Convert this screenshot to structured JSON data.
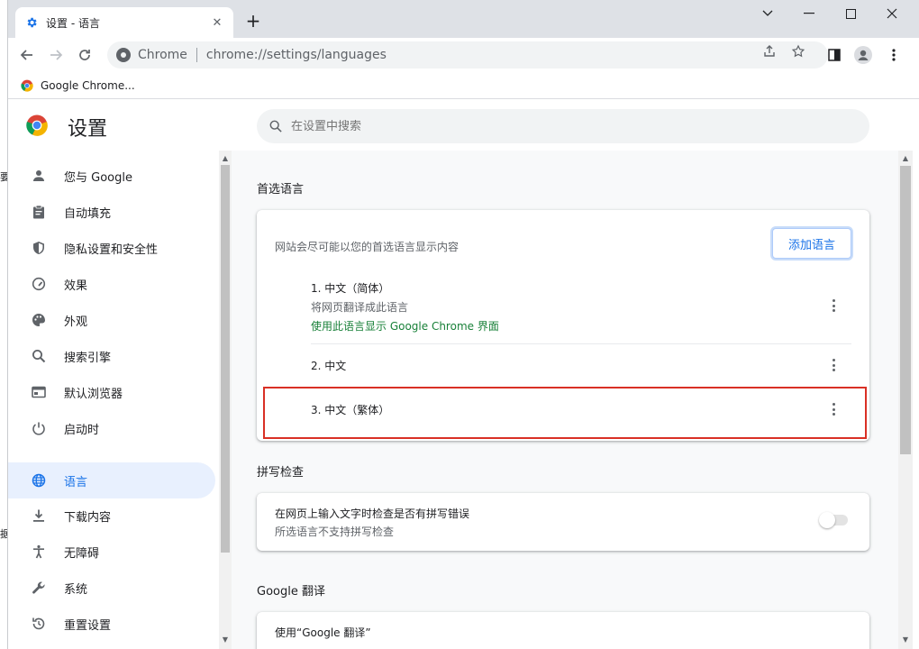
{
  "window": {
    "tab_title": "设置 - 语言",
    "tab_close": "✕",
    "new_tab": "+"
  },
  "toolbar": {
    "chip_label": "Chrome",
    "url": "chrome://settings/languages"
  },
  "bookmarks": [
    {
      "label": "Google Chrome..."
    }
  ],
  "settings": {
    "title": "设置",
    "search_placeholder": "在设置中搜索"
  },
  "sidebar": {
    "items": [
      {
        "label": "您与 Google",
        "icon": "person-icon"
      },
      {
        "label": "自动填充",
        "icon": "clipboard-icon"
      },
      {
        "label": "隐私设置和安全性",
        "icon": "shield-icon"
      },
      {
        "label": "效果",
        "icon": "speedometer-icon"
      },
      {
        "label": "外观",
        "icon": "palette-icon"
      },
      {
        "label": "搜索引擎",
        "icon": "search-icon"
      },
      {
        "label": "默认浏览器",
        "icon": "browser-icon"
      },
      {
        "label": "启动时",
        "icon": "power-icon"
      },
      {
        "label": "语言",
        "icon": "globe-icon",
        "active": true
      },
      {
        "label": "下载内容",
        "icon": "download-icon"
      },
      {
        "label": "无障碍",
        "icon": "accessibility-icon"
      },
      {
        "label": "系统",
        "icon": "wrench-icon"
      },
      {
        "label": "重置设置",
        "icon": "reset-icon"
      }
    ]
  },
  "preferred_languages": {
    "section_title": "首选语言",
    "description": "网站会尽可能以您的首选语言显示内容",
    "add_button": "添加语言",
    "languages": [
      {
        "name": "1. 中文（简体）",
        "sub1": "将网页翻译成此语言",
        "sub2": "使用此语言显示 Google Chrome 界面"
      },
      {
        "name": "2. 中文"
      },
      {
        "name": "3. 中文（繁体）"
      }
    ]
  },
  "spell_check": {
    "section_title": "拼写检查",
    "title": "在网页上输入文字时检查是否有拼写错误",
    "subtitle": "所选语言不支持拼写检查",
    "enabled": false
  },
  "translate": {
    "section_title": "Google 翻译",
    "item": "使用“Google 翻译”"
  },
  "colors": {
    "accent": "#1a73e8",
    "active_bg": "#e8f0fe",
    "green_text": "#188038",
    "highlight": "#d93025"
  },
  "background_window": {
    "fragments": [
      "要",
      "据"
    ]
  }
}
